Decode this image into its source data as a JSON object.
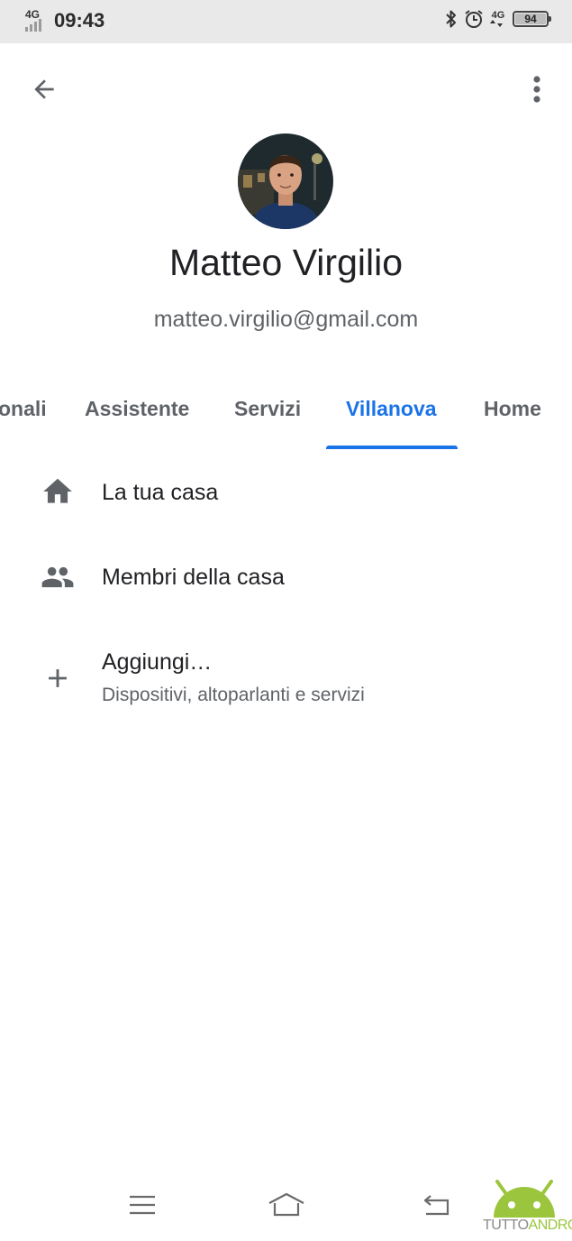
{
  "status_bar": {
    "network_left": "4G",
    "time": "09:43",
    "network_right": "4G",
    "battery_level": "94",
    "icons": [
      "bluetooth-icon",
      "alarm-icon",
      "battery-icon"
    ]
  },
  "toolbar": {
    "back_icon": "arrow-back-icon",
    "more_icon": "more-vert-icon"
  },
  "profile": {
    "name": "Matteo Virgilio",
    "email": "matteo.virgilio@gmail.com"
  },
  "tabs": [
    {
      "label": "onali",
      "active": false
    },
    {
      "label": "Assistente",
      "active": false
    },
    {
      "label": "Servizi",
      "active": false
    },
    {
      "label": "Villanova",
      "active": true
    },
    {
      "label": "Home",
      "active": false
    }
  ],
  "list": [
    {
      "icon": "home-icon",
      "title": "La tua casa"
    },
    {
      "icon": "people-icon",
      "title": "Membri della casa"
    },
    {
      "icon": "add-icon",
      "title": "Aggiungi…",
      "subtitle": "Dispositivi, altoparlanti e servizi"
    }
  ],
  "nav_bar": {
    "icons": [
      "menu-icon",
      "home-nav-icon",
      "back-nav-icon"
    ]
  },
  "watermark": {
    "part1": "TUTTO",
    "part2": "ANDROID"
  },
  "colors": {
    "accent": "#1a73e8",
    "icon_gray": "#5f6368",
    "status_bar_bg": "#e9e9e9",
    "watermark_green": "#9bc53d"
  }
}
